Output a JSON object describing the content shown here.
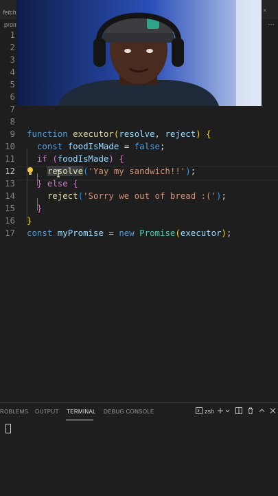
{
  "tabs": {
    "file_tab": "fetch_",
    "close_glyph": "×"
  },
  "breadcrumb": {
    "text": "prom",
    "more": "…"
  },
  "editor": {
    "active_line": 12,
    "line_numbers": [
      "1",
      "2",
      "3",
      "4",
      "5",
      "6",
      "7",
      "8",
      "9",
      "10",
      "11",
      "12",
      "13",
      "14",
      "15",
      "16",
      "17"
    ],
    "lines": [
      {
        "n": 9,
        "tokens": [
          [
            "kw",
            "function"
          ],
          [
            "pl",
            " "
          ],
          [
            "fn",
            "executor"
          ],
          [
            "br1",
            "("
          ],
          [
            "var",
            "resolve"
          ],
          [
            "pl",
            ", "
          ],
          [
            "var",
            "reject"
          ],
          [
            "br1",
            ")"
          ],
          [
            "pl",
            " "
          ],
          [
            "br1",
            "{"
          ]
        ]
      },
      {
        "n": 10,
        "tokens": [
          [
            "pl",
            "  "
          ],
          [
            "kw",
            "const"
          ],
          [
            "pl",
            " "
          ],
          [
            "var",
            "foodIsMade"
          ],
          [
            "pl",
            " = "
          ],
          [
            "kw",
            "false"
          ],
          [
            "pl",
            ";"
          ]
        ]
      },
      {
        "n": 11,
        "tokens": [
          [
            "pl",
            "  "
          ],
          [
            "kw2",
            "if"
          ],
          [
            "pl",
            " "
          ],
          [
            "br2",
            "("
          ],
          [
            "var",
            "foodIsMade"
          ],
          [
            "br2",
            ")"
          ],
          [
            "pl",
            " "
          ],
          [
            "br2",
            "{"
          ]
        ]
      },
      {
        "n": 12,
        "tokens": [
          [
            "pl",
            "    "
          ],
          [
            "fn",
            "resolve"
          ],
          [
            "br3",
            "("
          ],
          [
            "str",
            "'Yay my sandwich!!'"
          ],
          [
            "br3",
            ")"
          ],
          [
            "pl",
            ";"
          ]
        ]
      },
      {
        "n": 13,
        "tokens": [
          [
            "pl",
            "  "
          ],
          [
            "br2",
            "}"
          ],
          [
            "pl",
            " "
          ],
          [
            "kw2",
            "else"
          ],
          [
            "pl",
            " "
          ],
          [
            "br2",
            "{"
          ]
        ]
      },
      {
        "n": 14,
        "tokens": [
          [
            "pl",
            "    "
          ],
          [
            "fn",
            "reject"
          ],
          [
            "br3",
            "("
          ],
          [
            "str",
            "'Sorry we out of bread :('"
          ],
          [
            "br3",
            ")"
          ],
          [
            "pl",
            ";"
          ]
        ]
      },
      {
        "n": 15,
        "tokens": [
          [
            "pl",
            "  "
          ],
          [
            "br2",
            "}"
          ]
        ]
      },
      {
        "n": 16,
        "tokens": [
          [
            "br1",
            "}"
          ]
        ]
      },
      {
        "n": 17,
        "tokens": [
          [
            "kw",
            "const"
          ],
          [
            "pl",
            " "
          ],
          [
            "var",
            "myPromise"
          ],
          [
            "pl",
            " = "
          ],
          [
            "kw",
            "new"
          ],
          [
            "pl",
            " "
          ],
          [
            "cls",
            "Promise"
          ],
          [
            "br1",
            "("
          ],
          [
            "var",
            "executor"
          ],
          [
            "br1",
            ")"
          ],
          [
            "pl",
            ";"
          ]
        ]
      }
    ]
  },
  "panel": {
    "tabs": [
      "ROBLEMS",
      "OUTPUT",
      "TERMINAL",
      "DEBUG CONSOLE"
    ],
    "active_tab": "TERMINAL",
    "terminal_shell": "zsh",
    "icons": [
      "terminal-icon",
      "plus-icon",
      "chevron-down-icon",
      "split-icon",
      "trash-icon",
      "chevron-up-icon",
      "close-icon"
    ]
  },
  "colors": {
    "editor_bg": "#1e1e1e",
    "keyword": "#569cd6",
    "function": "#dcdcaa",
    "variable": "#9cdcfe",
    "string": "#ce9178",
    "class": "#4ec9b0"
  }
}
